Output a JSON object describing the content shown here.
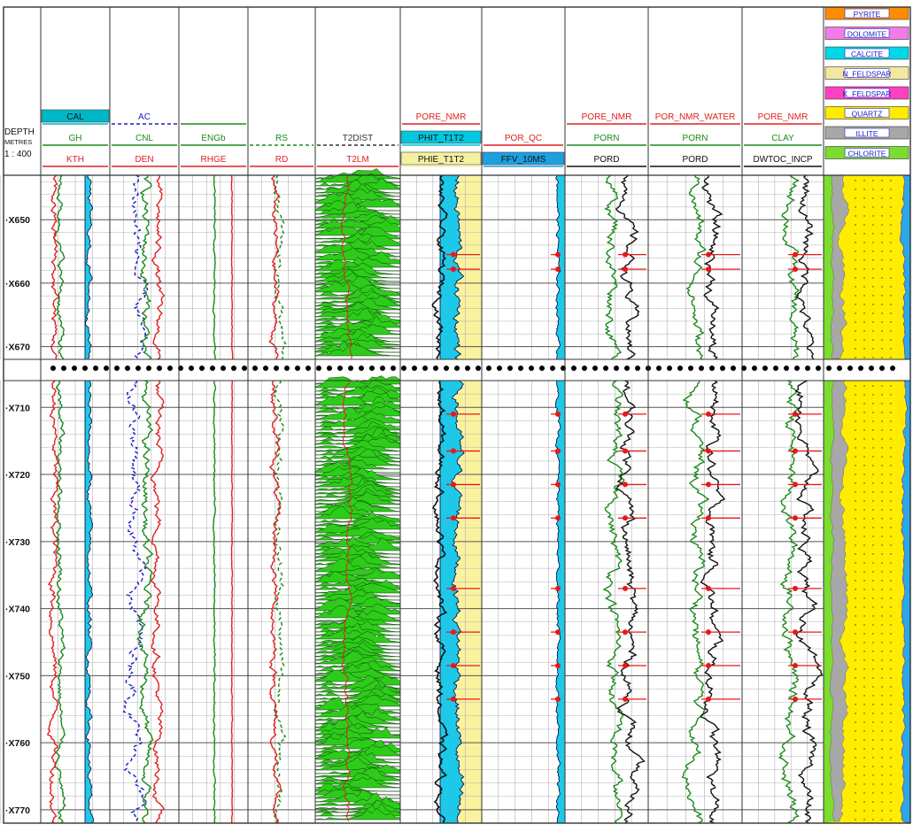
{
  "depth_header": {
    "title": "DEPTH",
    "unit": "METRES",
    "scale": "1 : 400"
  },
  "tracks": [
    {
      "id": "t1",
      "curves": [
        {
          "mnemonic": "CAL",
          "color": "#00b7c8",
          "style": "solid",
          "boxed": true
        },
        {
          "mnemonic": "GH",
          "color": "#1a8a1a",
          "style": "solid"
        },
        {
          "mnemonic": "KTH",
          "color": "#e02020",
          "style": "solid"
        }
      ]
    },
    {
      "id": "t2",
      "curves": [
        {
          "mnemonic": "AC",
          "color": "#1c1ccc",
          "style": "dashed"
        },
        {
          "mnemonic": "CNL",
          "color": "#1a8a1a",
          "style": "solid"
        },
        {
          "mnemonic": "DEN",
          "color": "#e02020",
          "style": "solid"
        }
      ]
    },
    {
      "id": "t3",
      "curves": [
        {
          "mnemonic": "",
          "color": "#1a8a1a",
          "style": "solid"
        },
        {
          "mnemonic": "ENGb",
          "color": "#1a8a1a",
          "style": "solid"
        },
        {
          "mnemonic": "RHGE",
          "color": "#e02020",
          "style": "solid"
        }
      ]
    },
    {
      "id": "t4",
      "curves": [
        {
          "mnemonic": "RS",
          "color": "#1a8a1a",
          "style": "dashed"
        },
        {
          "mnemonic": "RD",
          "color": "#e02020",
          "style": "solid"
        }
      ]
    },
    {
      "id": "t5",
      "curves": [
        {
          "mnemonic": "T2DIST",
          "color": "#333333",
          "style": "dashed"
        },
        {
          "mnemonic": "T2LM",
          "color": "#e02020",
          "style": "solid"
        }
      ]
    },
    {
      "id": "t6",
      "curves": [
        {
          "mnemonic": "PORE_NMR",
          "color": "#e02020",
          "style": "solid"
        },
        {
          "mnemonic": "PHIT_T1T2",
          "color": "#00c8e0",
          "style": "solid",
          "boxed": true
        },
        {
          "mnemonic": "PHIE_T1T2",
          "color": "#f5f0a0",
          "style": "solid",
          "boxed": true
        }
      ]
    },
    {
      "id": "t7",
      "curves": [
        {
          "mnemonic": "POR_QC",
          "color": "#e02020",
          "style": "solid"
        },
        {
          "mnemonic": "FFV_10MS",
          "color": "#1ca0e0",
          "style": "solid",
          "boxed": true
        }
      ]
    },
    {
      "id": "t8",
      "curves": [
        {
          "mnemonic": "PORE_NMR",
          "color": "#e02020",
          "style": "solid"
        },
        {
          "mnemonic": "PORN",
          "color": "#1a8a1a",
          "style": "solid"
        },
        {
          "mnemonic": "PORD",
          "color": "#111111",
          "style": "solid"
        }
      ]
    },
    {
      "id": "t9",
      "curves": [
        {
          "mnemonic": "POR_NMR_WATER",
          "color": "#e02020",
          "style": "solid"
        },
        {
          "mnemonic": "PORN",
          "color": "#1a8a1a",
          "style": "solid"
        },
        {
          "mnemonic": "PORD",
          "color": "#111111",
          "style": "solid"
        }
      ]
    },
    {
      "id": "t10",
      "curves": [
        {
          "mnemonic": "PORE_NMR",
          "color": "#e02020",
          "style": "solid"
        },
        {
          "mnemonic": "CLAY",
          "color": "#1a8a1a",
          "style": "solid"
        },
        {
          "mnemonic": "DWTOC_INCP",
          "color": "#111111",
          "style": "solid"
        }
      ]
    }
  ],
  "mineral_legend": [
    {
      "name": "PYRITE",
      "color": "#ff8c00"
    },
    {
      "name": "DOLOMITE",
      "color": "#f07ce8"
    },
    {
      "name": "CALCITE",
      "color": "#00d8e8"
    },
    {
      "name": "N_FELDSPAR",
      "color": "#f2e8a0"
    },
    {
      "name": "K_FELDSPAR",
      "color": "#ff40c0"
    },
    {
      "name": "QUARTZ",
      "color": "#ffec00"
    },
    {
      "name": "ILLITE",
      "color": "#a8a8a8"
    },
    {
      "name": "CHLORITE",
      "color": "#7cdc30"
    }
  ],
  "chart_data": {
    "type": "line",
    "plot": "well log composite",
    "y_axis": "depth",
    "segments": [
      {
        "top_depth": 643,
        "base_depth": 672,
        "depth_ticks": [
          "X650",
          "X660",
          "X670"
        ]
      },
      {
        "top_depth": 706,
        "base_depth": 772,
        "depth_ticks": [
          "X710",
          "X720",
          "X730",
          "X740",
          "X750",
          "X760",
          "X770"
        ]
      }
    ],
    "depth_tick_values": [
      650,
      660,
      670,
      710,
      720,
      730,
      740,
      750,
      760,
      770
    ],
    "break_between_segments": true,
    "grid": true
  },
  "colors": {
    "border": "#333333",
    "grid": "#b0b0b0",
    "nmr_green": "#2ecc1a",
    "cyan_fill": "#1ec8e8",
    "yellow_fill": "#fbf2a0",
    "quartz": "#ffec00",
    "illite": "#a8a8a8",
    "chlorite": "#7cdc30",
    "pore_marker": "#e81818"
  }
}
